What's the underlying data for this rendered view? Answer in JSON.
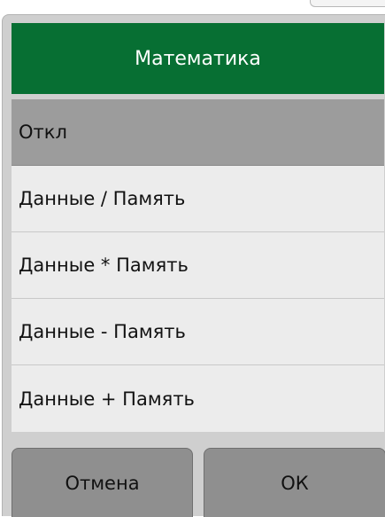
{
  "dialog": {
    "title": "Математика",
    "options": [
      {
        "label": "Откл",
        "selected": true
      },
      {
        "label": "Данные / Память",
        "selected": false
      },
      {
        "label": "Данные * Память",
        "selected": false
      },
      {
        "label": "Данные - Память",
        "selected": false
      },
      {
        "label": "Данные + Память",
        "selected": false
      }
    ],
    "cancel_label": "Отмена",
    "ok_label": "ОК"
  },
  "colors": {
    "title_bg": "#076f33",
    "selected_bg": "#9c9c9c",
    "option_bg": "#ececec",
    "button_bg": "#8f8f8f"
  }
}
